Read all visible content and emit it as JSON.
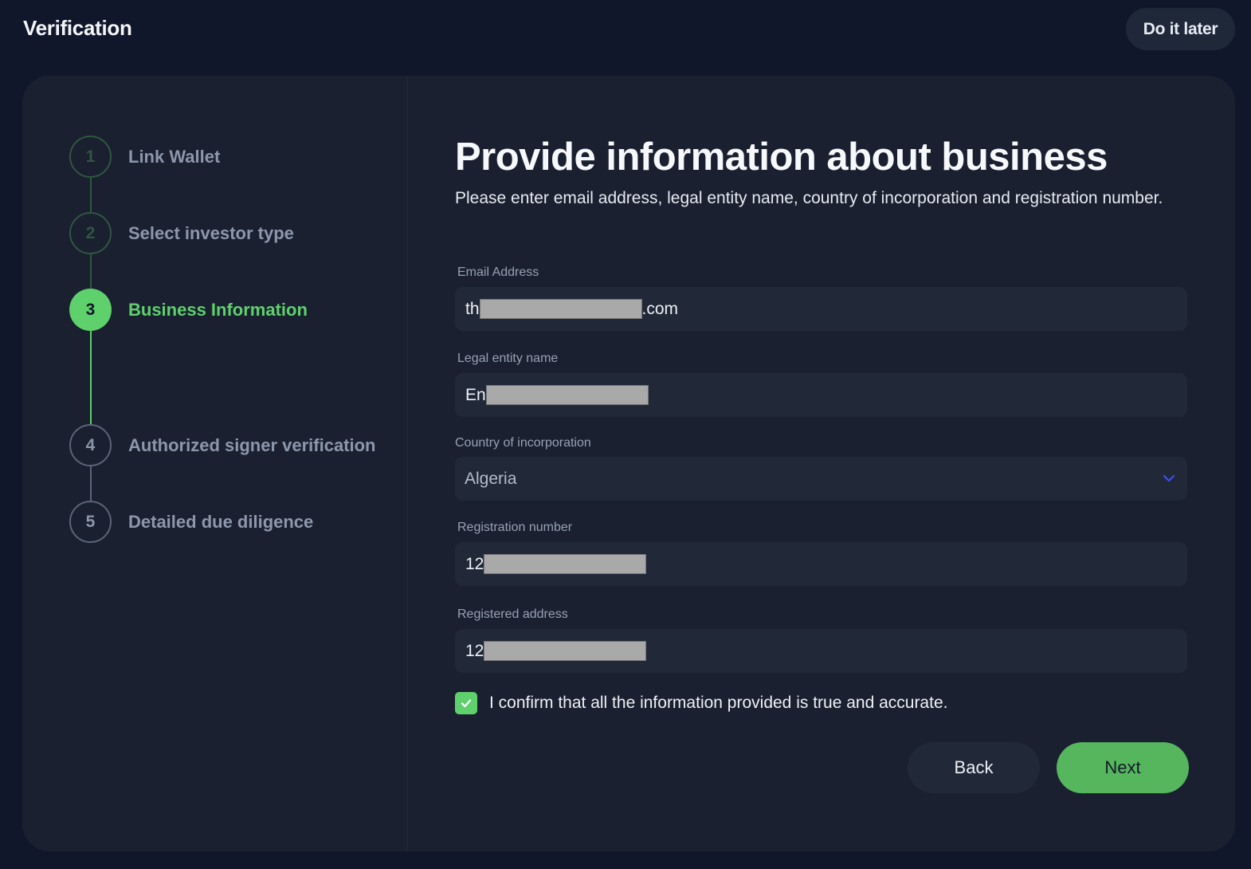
{
  "header": {
    "title": "Verification",
    "do_it_later_label": "Do it later"
  },
  "stepper": {
    "steps": [
      {
        "number": "1",
        "label": "Link Wallet",
        "state": "completed"
      },
      {
        "number": "2",
        "label": "Select investor type",
        "state": "completed"
      },
      {
        "number": "3",
        "label": "Business Information",
        "state": "active"
      },
      {
        "number": "4",
        "label": "Authorized signer verification",
        "state": "pending"
      },
      {
        "number": "5",
        "label": "Detailed due diligence",
        "state": "pending"
      }
    ]
  },
  "form": {
    "title": "Provide information about business",
    "description": "Please enter email address, legal entity name, country of incorporation and registration number.",
    "fields": {
      "email": {
        "label": "Email Address",
        "value_prefix": "th",
        "value_suffix": ".com",
        "redacted": true
      },
      "legal_entity_name": {
        "label": "Legal entity name",
        "value_prefix": "En",
        "value_suffix": "",
        "redacted": true
      },
      "country": {
        "label": "Country of incorporation",
        "value": "Algeria",
        "icon": "chevron-down-icon"
      },
      "registration_number": {
        "label": "Registration number",
        "value_prefix": "12",
        "value_suffix": "",
        "redacted": true
      },
      "registered_address": {
        "label": "Registered address",
        "value_prefix": "12",
        "value_suffix": "",
        "redacted": true
      }
    },
    "confirm": {
      "checked": true,
      "label": "I confirm that all the information provided is true and accurate."
    },
    "back_label": "Back",
    "next_label": "Next"
  },
  "colors": {
    "background": "#11172a",
    "card": "#1a2030",
    "input": "#212939",
    "accent_green": "#5fd16c",
    "button_green": "#55b65e",
    "chevron_blue": "#3d4ff0"
  }
}
